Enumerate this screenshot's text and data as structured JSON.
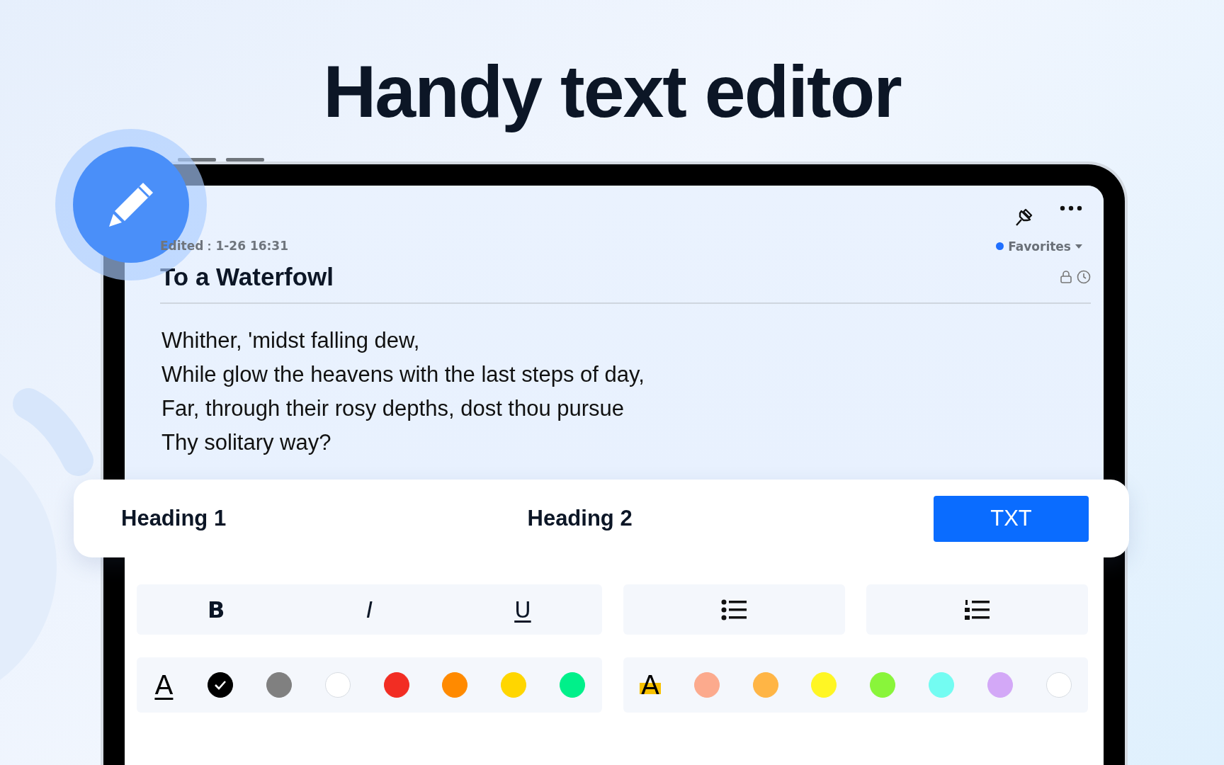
{
  "headline": "Handy text editor",
  "note": {
    "edited": "Edited：1-26 16:31",
    "folder": {
      "label": "Favorites",
      "color": "#1f6fff"
    },
    "title": "To a Waterfowl",
    "lines": [
      "Whither, 'midst falling dew,",
      "While glow the heavens with the last steps of day,",
      "Far, through their rosy depths, dost thou pursue",
      "Thy solitary way?"
    ]
  },
  "styles": [
    {
      "label": "Heading 1",
      "selected": false
    },
    {
      "label": "Heading 2",
      "selected": false
    },
    {
      "label": "TXT",
      "selected": true
    }
  ],
  "format_buttons": [
    "B",
    "I",
    "U"
  ],
  "text_color": {
    "symbol": "A",
    "swatches": [
      {
        "color": "#000000",
        "selected": true
      },
      {
        "color": "#808080",
        "selected": false
      },
      {
        "color": "#ffffff",
        "selected": false
      },
      {
        "color": "#f22d23",
        "selected": false
      },
      {
        "color": "#ff8a00",
        "selected": false
      },
      {
        "color": "#ffd600",
        "selected": false
      },
      {
        "color": "#00f08a",
        "selected": false
      }
    ]
  },
  "highlight_color": {
    "symbol": "A",
    "swatches": [
      {
        "color": "#fcaa8d",
        "selected": false
      },
      {
        "color": "#ffb545",
        "selected": false
      },
      {
        "color": "#fff624",
        "selected": false
      },
      {
        "color": "#89f53a",
        "selected": false
      },
      {
        "color": "#73fcf2",
        "selected": false
      },
      {
        "color": "#d3a8f7",
        "selected": false
      },
      {
        "color": "#ffffff",
        "selected": false
      }
    ]
  }
}
